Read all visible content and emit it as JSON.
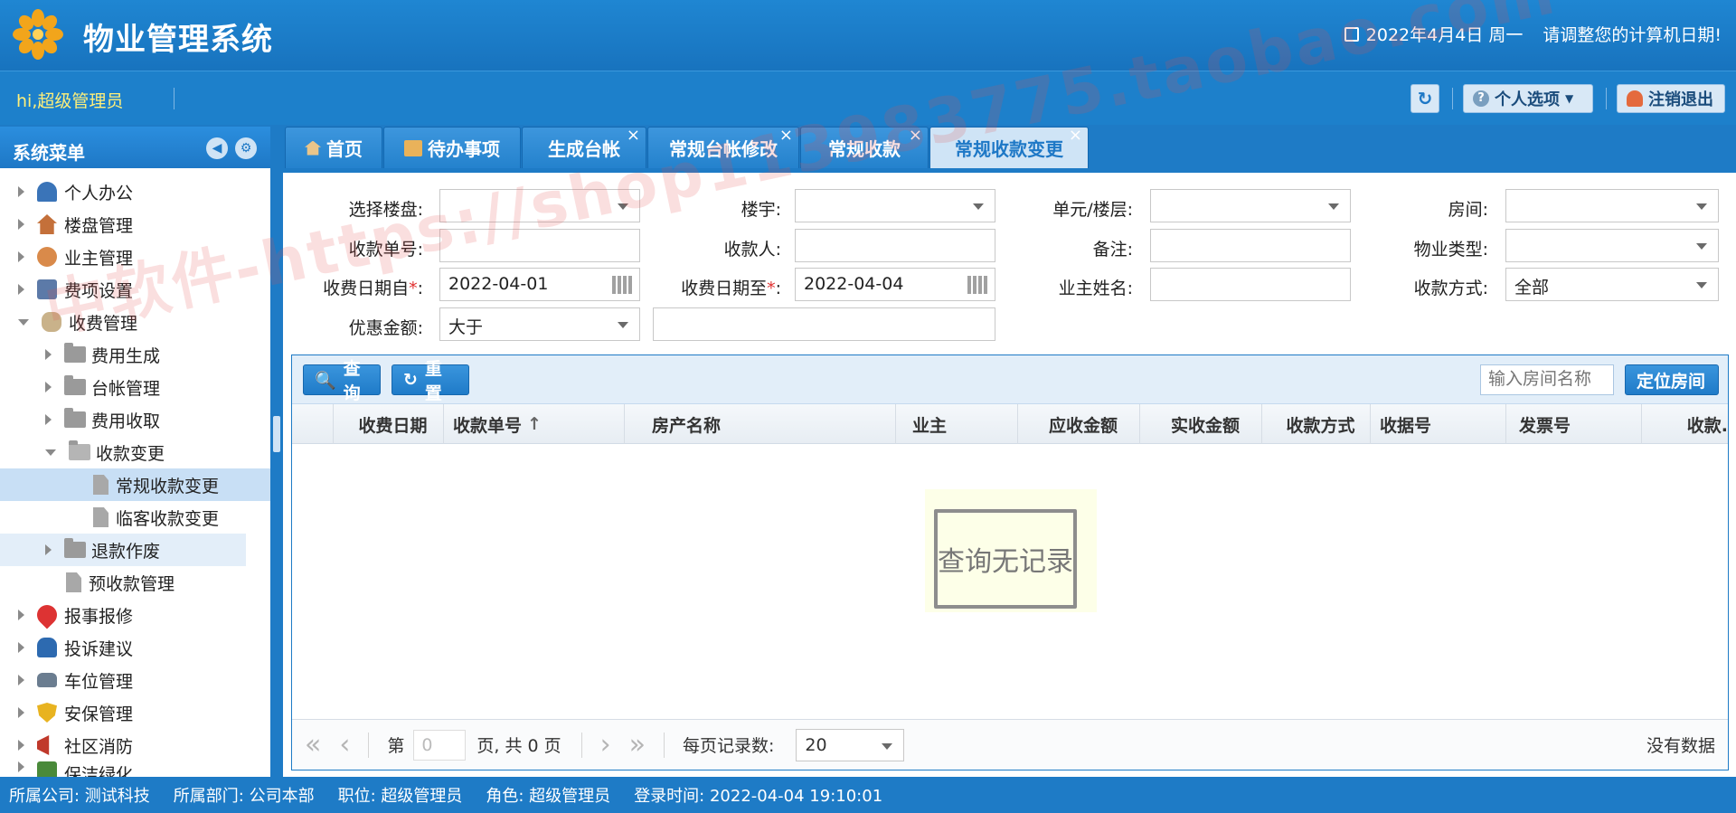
{
  "app": {
    "title": "物业管理系统",
    "date": "2022年4月4日 周一",
    "date_hint": "请调整您的计算机日期!"
  },
  "user": {
    "greeting": "hi,超级管理员",
    "personal_label": "个人选项",
    "logout_label": "注销退出"
  },
  "sidebar": {
    "title": "系统菜单",
    "items": [
      {
        "label": "个人办公"
      },
      {
        "label": "楼盘管理"
      },
      {
        "label": "业主管理"
      },
      {
        "label": "费项设置"
      },
      {
        "label": "收费管理"
      },
      {
        "label": "费用生成"
      },
      {
        "label": "台帐管理"
      },
      {
        "label": "费用收取"
      },
      {
        "label": "收款变更"
      },
      {
        "label": "常规收款变更"
      },
      {
        "label": "临客收款变更"
      },
      {
        "label": "退款作废"
      },
      {
        "label": "预收款管理"
      },
      {
        "label": "报事报修"
      },
      {
        "label": "投诉建议"
      },
      {
        "label": "车位管理"
      },
      {
        "label": "安保管理"
      },
      {
        "label": "社区消防"
      },
      {
        "label": "保洁绿化"
      }
    ]
  },
  "tabs": [
    {
      "label": "首页"
    },
    {
      "label": "待办事项"
    },
    {
      "label": "生成台帐"
    },
    {
      "label": "常规台帐修改"
    },
    {
      "label": "常规收款"
    },
    {
      "label": "常规收款变更"
    }
  ],
  "form": {
    "building_label": "选择楼盘:",
    "block_label": "楼宇:",
    "unit_label": "单元/楼层:",
    "room_label": "房间:",
    "receipt_no_label": "收款单号:",
    "payee_label": "收款人:",
    "remark_label": "备注:",
    "property_type_label": "物业类型:",
    "date_from_label": "收费日期自",
    "date_from": "2022-04-01",
    "date_to_label": "收费日期至",
    "date_to": "2022-04-04",
    "owner_label": "业主姓名:",
    "pay_method_label": "收款方式:",
    "pay_method": "全部",
    "discount_label": "优惠金额:",
    "discount_op": "大于",
    "req_mark": "*",
    "colon": ":"
  },
  "grid": {
    "query_label": "查询",
    "reset_label": "重置",
    "room_search_placeholder": "输入房间名称",
    "locate_label": "定位房间",
    "columns": [
      "收费日期",
      "收款单号",
      "房产名称",
      "业主",
      "应收金额",
      "实收金额",
      "收款方式",
      "收据号",
      "发票号",
      "收款."
    ],
    "sort_mark": "↑",
    "empty_text": "查询无记录"
  },
  "pager": {
    "page_prefix": "第",
    "page_value": "0",
    "page_suffix": "页, 共 0 页",
    "per_page_label": "每页记录数:",
    "per_page": "20",
    "status": "没有数据"
  },
  "status": {
    "company": "所属公司:  测试科技",
    "dept": "所属部门:  公司本部",
    "position": "职位:  超级管理员",
    "role": "角色:  超级管理员",
    "login": "登录时间:  2022-04-04 19:10:01"
  },
  "watermark": "中软件-https://shop113983775.taobao.com",
  "colors": {
    "primary": "#1e7bc6",
    "active_tab": "#cfe4f6",
    "greeting": "#ffef7a",
    "required": "#e03030"
  }
}
